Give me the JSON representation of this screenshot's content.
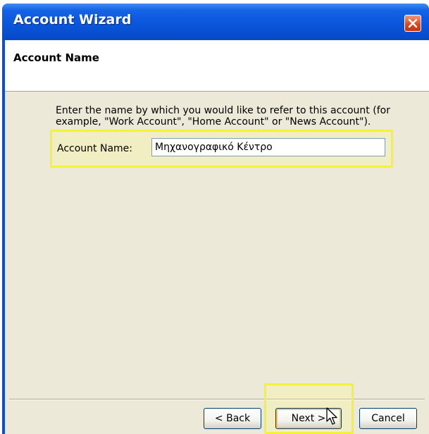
{
  "window": {
    "title": "Account Wizard",
    "close_icon": "close-icon"
  },
  "header": {
    "title": "Account Name"
  },
  "content": {
    "description": "Enter the name by which you would like to refer to this account (for example, \"Work Account\", \"Home Account\" or \"News Account\").",
    "account_name_label": "Account Name:",
    "account_name_value": "Μηχανογραφικό Κέντρο"
  },
  "buttons": {
    "back": "< Back",
    "next": "Next >",
    "cancel": "Cancel"
  },
  "colors": {
    "titlebar": "#0a56dc",
    "dialog_bg": "#ece9d8",
    "highlight": "#f2f23a"
  }
}
